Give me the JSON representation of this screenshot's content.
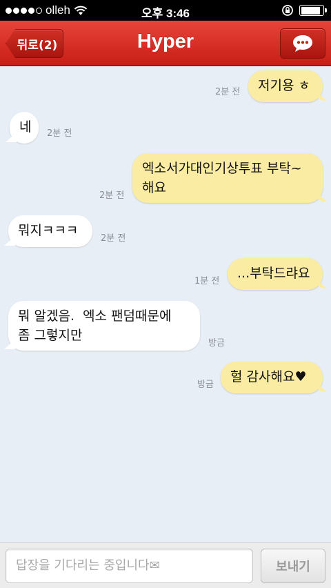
{
  "status_bar": {
    "carrier": "olleh",
    "time": "오후 3:46",
    "battery_percent": 90
  },
  "nav": {
    "back_label": "뒤로(2)",
    "title": "Hyper",
    "chat_icon": "speech-bubble-icon"
  },
  "messages": [
    {
      "sender": "me",
      "text": "저기용 ㅎ",
      "time": "2분 전"
    },
    {
      "sender": "them",
      "text": "네",
      "time": "2분 전"
    },
    {
      "sender": "me",
      "text": "엑소서가대인기상투표 부탁~\n해요",
      "time": "2분 전"
    },
    {
      "sender": "them",
      "text": "뭐지ㅋㅋㅋ",
      "time": "2분 전"
    },
    {
      "sender": "me",
      "text": "...부탁드랴요",
      "time": "1분 전"
    },
    {
      "sender": "them",
      "text": "뭐 알겠음.  엑소 팬덤때문에\n좀 그렇지만",
      "time": "방금"
    },
    {
      "sender": "me",
      "text": "헐 감사해요♥",
      "time": "방금"
    }
  ],
  "input": {
    "placeholder": "답장을 기다리는 중입니다✉",
    "send_label": "보내기"
  },
  "colors": {
    "nav_red": "#d3291f",
    "my_bubble": "#fbeca4",
    "their_bubble": "#ffffff"
  }
}
